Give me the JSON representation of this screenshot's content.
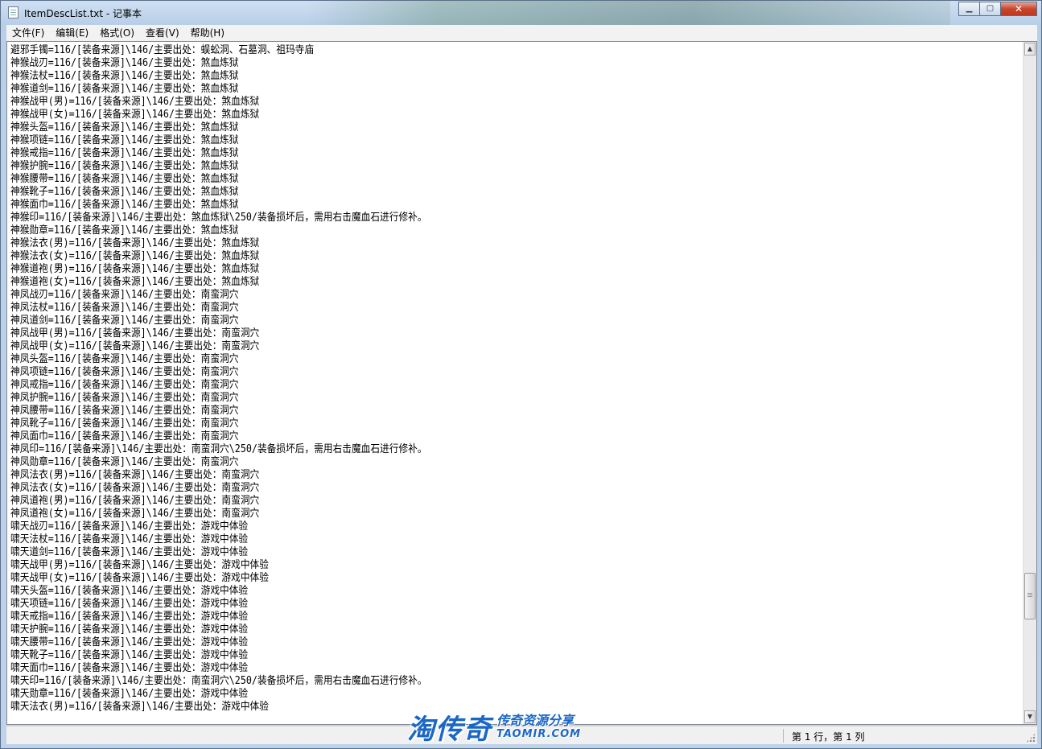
{
  "window": {
    "title": "ItemDescList.txt - 记事本",
    "minimize_glyph": "▁",
    "maximize_glyph": "▢",
    "close_glyph": "✕"
  },
  "menubar": {
    "items": [
      {
        "label": "文件(F)"
      },
      {
        "label": "编辑(E)"
      },
      {
        "label": "格式(O)"
      },
      {
        "label": "查看(V)"
      },
      {
        "label": "帮助(H)"
      }
    ]
  },
  "editor": {
    "lines": [
      "避邪手镯=116/[装备来源]\\146/主要出处：蜈蚣洞、石墓洞、祖玛寺庙",
      "神猴战刃=116/[装备来源]\\146/主要出处：煞血炼狱",
      "神猴法杖=116/[装备来源]\\146/主要出处：煞血炼狱",
      "神猴道剑=116/[装备来源]\\146/主要出处：煞血炼狱",
      "神猴战甲(男)=116/[装备来源]\\146/主要出处：煞血炼狱",
      "神猴战甲(女)=116/[装备来源]\\146/主要出处：煞血炼狱",
      "神猴头盔=116/[装备来源]\\146/主要出处：煞血炼狱",
      "神猴项链=116/[装备来源]\\146/主要出处：煞血炼狱",
      "神猴戒指=116/[装备来源]\\146/主要出处：煞血炼狱",
      "神猴护腕=116/[装备来源]\\146/主要出处：煞血炼狱",
      "神猴腰带=116/[装备来源]\\146/主要出处：煞血炼狱",
      "神猴靴子=116/[装备来源]\\146/主要出处：煞血炼狱",
      "神猴面巾=116/[装备来源]\\146/主要出处：煞血炼狱",
      "神猴印=116/[装备来源]\\146/主要出处：煞血炼狱\\250/装备损坏后，需用右击魔血石进行修补。",
      "神猴勋章=116/[装备来源]\\146/主要出处：煞血炼狱",
      "神猴法衣(男)=116/[装备来源]\\146/主要出处：煞血炼狱",
      "神猴法衣(女)=116/[装备来源]\\146/主要出处：煞血炼狱",
      "神猴道袍(男)=116/[装备来源]\\146/主要出处：煞血炼狱",
      "神猴道袍(女)=116/[装备来源]\\146/主要出处：煞血炼狱",
      "神凤战刃=116/[装备来源]\\146/主要出处：南蛮洞穴",
      "神凤法杖=116/[装备来源]\\146/主要出处：南蛮洞穴",
      "神凤道剑=116/[装备来源]\\146/主要出处：南蛮洞穴",
      "神凤战甲(男)=116/[装备来源]\\146/主要出处：南蛮洞穴",
      "神凤战甲(女)=116/[装备来源]\\146/主要出处：南蛮洞穴",
      "神凤头盔=116/[装备来源]\\146/主要出处：南蛮洞穴",
      "神凤项链=116/[装备来源]\\146/主要出处：南蛮洞穴",
      "神凤戒指=116/[装备来源]\\146/主要出处：南蛮洞穴",
      "神凤护腕=116/[装备来源]\\146/主要出处：南蛮洞穴",
      "神凤腰带=116/[装备来源]\\146/主要出处：南蛮洞穴",
      "神凤靴子=116/[装备来源]\\146/主要出处：南蛮洞穴",
      "神凤面巾=116/[装备来源]\\146/主要出处：南蛮洞穴",
      "神凤印=116/[装备来源]\\146/主要出处：南蛮洞穴\\250/装备损坏后，需用右击魔血石进行修补。",
      "神凤勋章=116/[装备来源]\\146/主要出处：南蛮洞穴",
      "神凤法衣(男)=116/[装备来源]\\146/主要出处：南蛮洞穴",
      "神凤法衣(女)=116/[装备来源]\\146/主要出处：南蛮洞穴",
      "神凤道袍(男)=116/[装备来源]\\146/主要出处：南蛮洞穴",
      "神凤道袍(女)=116/[装备来源]\\146/主要出处：南蛮洞穴",
      "啸天战刃=116/[装备来源]\\146/主要出处：游戏中体验",
      "啸天法杖=116/[装备来源]\\146/主要出处：游戏中体验",
      "啸天道剑=116/[装备来源]\\146/主要出处：游戏中体验",
      "啸天战甲(男)=116/[装备来源]\\146/主要出处：游戏中体验",
      "啸天战甲(女)=116/[装备来源]\\146/主要出处：游戏中体验",
      "啸天头盔=116/[装备来源]\\146/主要出处：游戏中体验",
      "啸天项链=116/[装备来源]\\146/主要出处：游戏中体验",
      "啸天戒指=116/[装备来源]\\146/主要出处：游戏中体验",
      "啸天护腕=116/[装备来源]\\146/主要出处：游戏中体验",
      "啸天腰带=116/[装备来源]\\146/主要出处：游戏中体验",
      "啸天靴子=116/[装备来源]\\146/主要出处：游戏中体验",
      "啸天面巾=116/[装备来源]\\146/主要出处：游戏中体验",
      "啸天印=116/[装备来源]\\146/主要出处：南蛮洞穴\\250/装备损坏后，需用右击魔血石进行修补。",
      "啸天勋章=116/[装备来源]\\146/主要出处：游戏中体验",
      "啸天法衣(男)=116/[装备来源]\\146/主要出处：游戏中体验"
    ]
  },
  "scrollbar": {
    "up_glyph": "▲",
    "down_glyph": "▼",
    "scroll_position": 0.85
  },
  "statusbar": {
    "position": "第 1 行，第 1 列"
  },
  "watermark": {
    "main": "淘传奇",
    "sub": "传奇资源分享",
    "url": "TAOMIR.COM"
  }
}
